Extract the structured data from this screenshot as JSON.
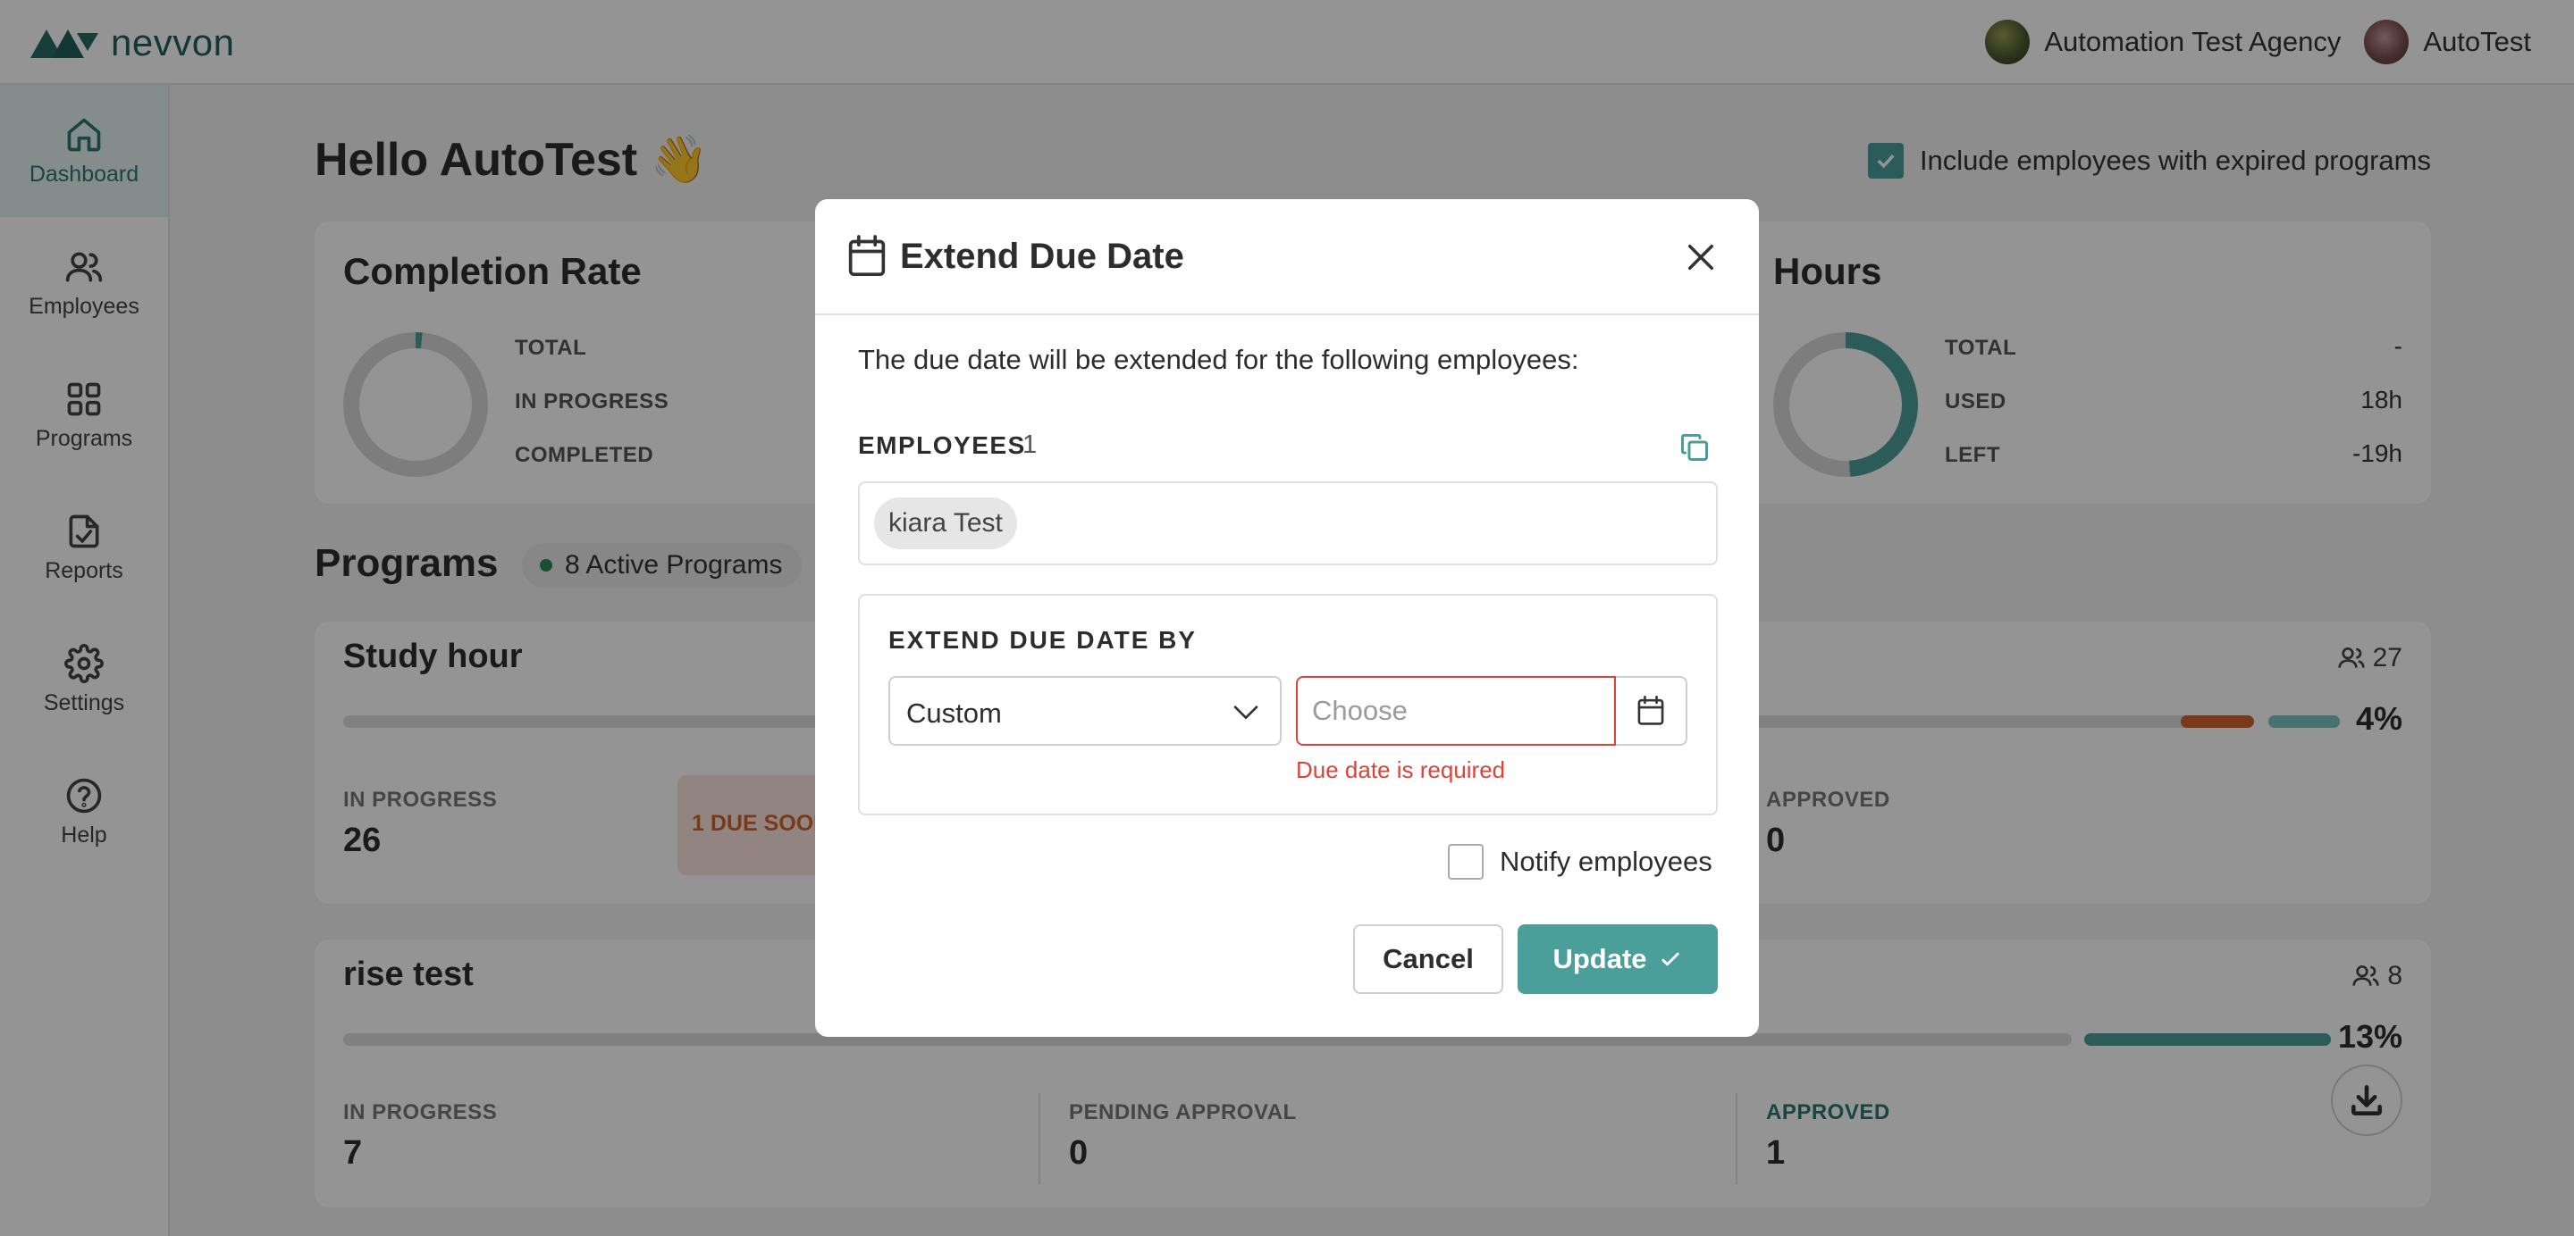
{
  "brand": {
    "name": "nevvon"
  },
  "topbar": {
    "agency": "Automation Test Agency",
    "user": "AutoTest"
  },
  "sidebar": {
    "items": [
      {
        "label": "Dashboard",
        "icon": "home-icon",
        "active": true
      },
      {
        "label": "Employees",
        "icon": "users-icon"
      },
      {
        "label": "Programs",
        "icon": "grid-icon"
      },
      {
        "label": "Reports",
        "icon": "report-icon"
      },
      {
        "label": "Settings",
        "icon": "gear-icon"
      },
      {
        "label": "Help",
        "icon": "help-icon"
      }
    ]
  },
  "dashboard": {
    "greeting": "Hello AutoTest 👋",
    "include_expired_label": "Include employees with expired programs",
    "include_expired_checked": true,
    "completion": {
      "title": "Completion Rate",
      "labels": {
        "total": "TOTAL",
        "in_progress": "IN PROGRESS",
        "completed": "COMPLETED"
      }
    },
    "hours": {
      "title": "Hours",
      "labels": {
        "total": "TOTAL",
        "used": "USED",
        "left": "LEFT"
      },
      "values": {
        "total": "-",
        "used": "18h",
        "left": "-19h"
      }
    },
    "programs_title": "Programs",
    "active_programs": "8 Active Programs",
    "programs": [
      {
        "name": "Study hour",
        "people": "27",
        "percent": "4%",
        "in_progress_label": "IN PROGRESS",
        "in_progress": "26",
        "due_soon": "1 DUE SOON",
        "approved_label": "APPROVED",
        "approved": "0"
      },
      {
        "name": "rise test",
        "people": "8",
        "percent": "13%",
        "in_progress_label": "IN PROGRESS",
        "in_progress": "7",
        "pending_label": "PENDING APPROVAL",
        "pending": "0",
        "approved_label": "APPROVED",
        "approved": "1"
      }
    ]
  },
  "modal": {
    "title": "Extend Due Date",
    "description": "The due date will be extended for the following employees:",
    "employees_label": "EMPLOYEES",
    "employees_count": "1",
    "employees": [
      "kiara Test"
    ],
    "extend_by_label": "EXTEND DUE DATE BY",
    "extend_by_value": "Custom",
    "date_placeholder": "Choose",
    "date_error": "Due date is required",
    "notify_label": "Notify employees",
    "notify_checked": false,
    "cancel_label": "Cancel",
    "update_label": "Update"
  },
  "colors": {
    "accent": "#4a9f9a",
    "error": "#d9453a",
    "warning": "#d2622e"
  }
}
